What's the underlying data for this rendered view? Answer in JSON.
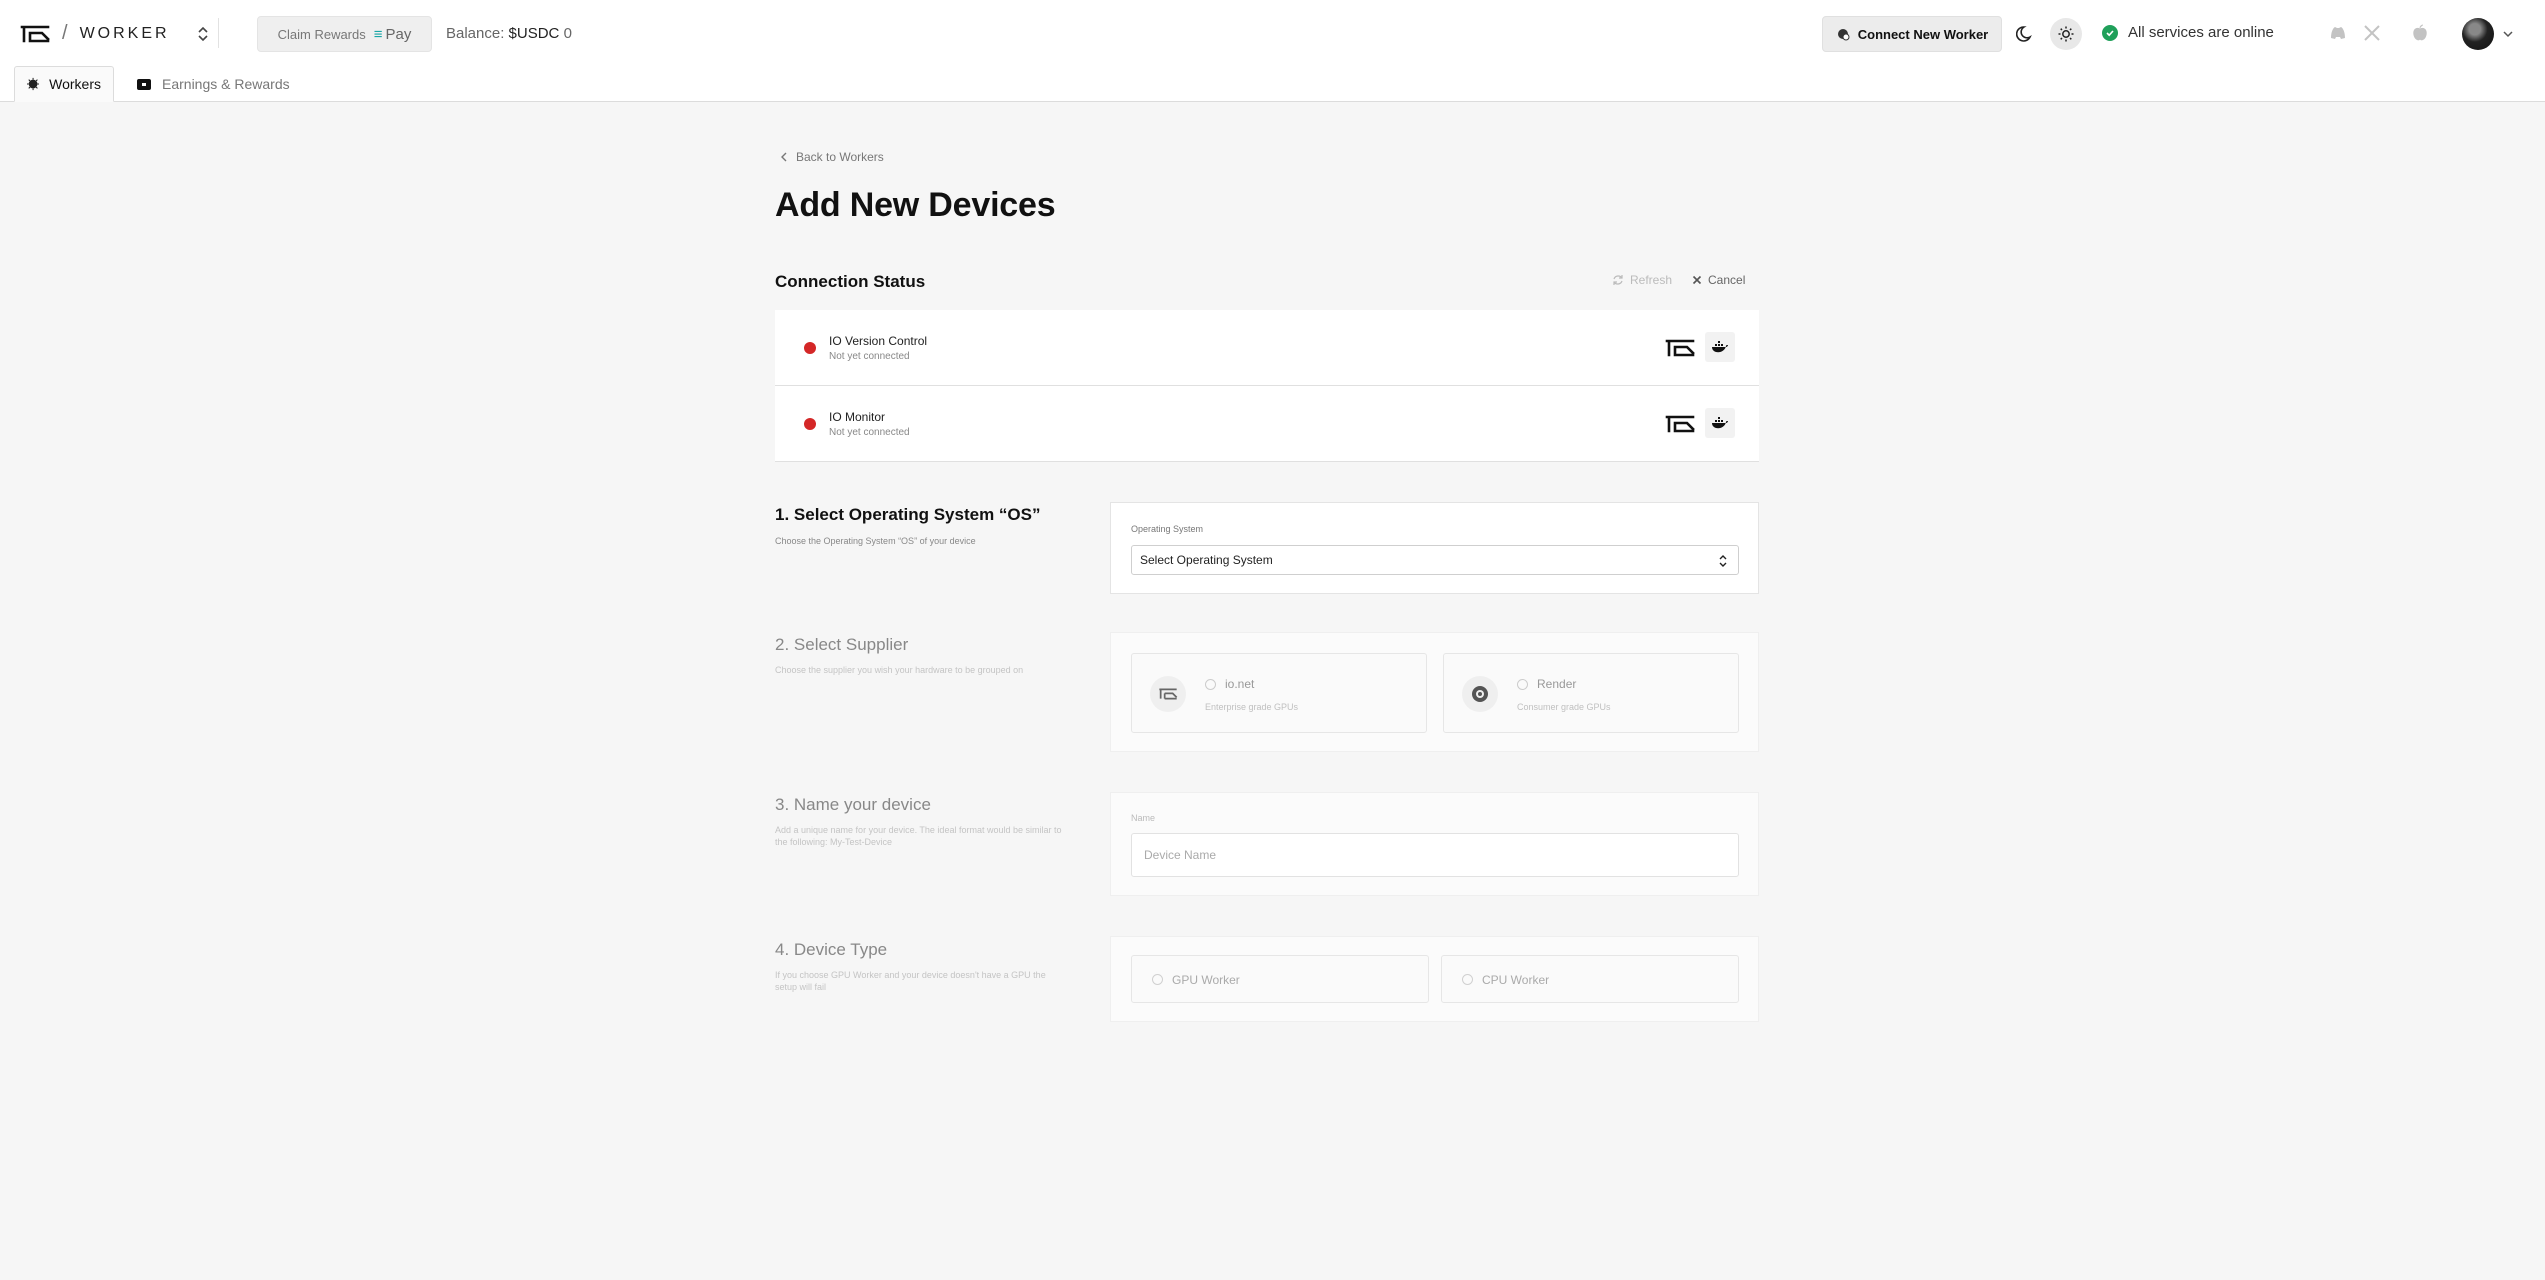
{
  "header": {
    "product": "WORKER",
    "separator": "/",
    "claim_label": "Claim Rewards",
    "pay_label": "Pay",
    "balance_label": "Balance:",
    "balance_currency": "$USDC",
    "balance_value": "0",
    "connect_label": "Connect New Worker",
    "status_text": "All services are online"
  },
  "tabs": [
    {
      "label": "Workers",
      "active": true
    },
    {
      "label": "Earnings & Rewards",
      "active": false
    }
  ],
  "main": {
    "back_label": "Back to Workers",
    "title": "Add New Devices",
    "connection_status_title": "Connection Status",
    "refresh_label": "Refresh",
    "cancel_label": "Cancel",
    "connections": [
      {
        "name": "IO Version Control",
        "status": "Not yet connected",
        "status_color": "#d42727"
      },
      {
        "name": "IO Monitor",
        "status": "Not yet connected",
        "status_color": "#d42727"
      }
    ],
    "sections": {
      "os": {
        "title": "1. Select Operating System “OS”",
        "description": "Choose the Operating System “OS” of your device",
        "field_label": "Operating System",
        "selected": "Select Operating System"
      },
      "supplier": {
        "title": "2. Select Supplier",
        "description": "Choose the supplier you wish your hardware to be grouped on",
        "options": [
          {
            "title": "io.net",
            "subtitle": "Enterprise grade GPUs"
          },
          {
            "title": "Render",
            "subtitle": "Consumer grade GPUs"
          }
        ]
      },
      "name": {
        "title": "3. Name your device",
        "description": "Add a unique name for your device. The ideal format would be similar to the following: My-Test-Device",
        "field_label": "Name",
        "placeholder": "Device Name"
      },
      "device_type": {
        "title": "4. Device Type",
        "description": "If you choose GPU Worker and your device doesn't have a GPU the setup will fail",
        "options": [
          "GPU Worker",
          "CPU Worker"
        ]
      }
    }
  },
  "colors": {
    "status_online": "#1fa05a",
    "not_connected": "#d42727",
    "pay_accent": "#18a6a6"
  }
}
